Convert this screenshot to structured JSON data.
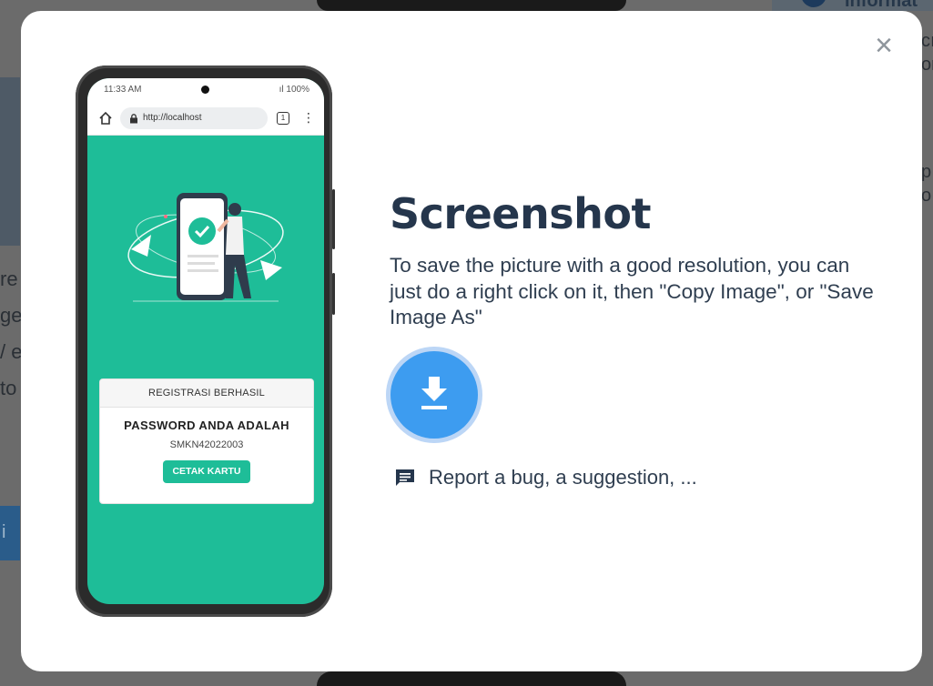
{
  "background": {
    "left_texts": [
      "re",
      "ge",
      "/ e",
      "to"
    ],
    "right_texts": [
      "cı",
      "or",
      "p",
      "o"
    ],
    "info_title": "Informat",
    "left_button_text": "i"
  },
  "modal": {
    "close_symbol": "×",
    "title": "Screenshot",
    "description": "To save the picture with a good resolution, you can just do a right click on it, then \"Copy Image\", or \"Save Image As\"",
    "download_icon": "download-icon",
    "report_text": "Report a bug, a suggestion, ...",
    "accent_color": "#3d9cf0",
    "title_color": "#25364c"
  },
  "phone": {
    "status_time": "11:33 AM",
    "status_right": "ıl 100%",
    "url": "http://localhost",
    "tab_count": "1",
    "menu": "⋮",
    "screen_color": "#1ebd98",
    "card": {
      "header": "REGISTRASI BERHASIL",
      "title": "PASSWORD ANDA ADALAH",
      "code": "SMKN42022003",
      "button": "CETAK KARTU"
    }
  }
}
